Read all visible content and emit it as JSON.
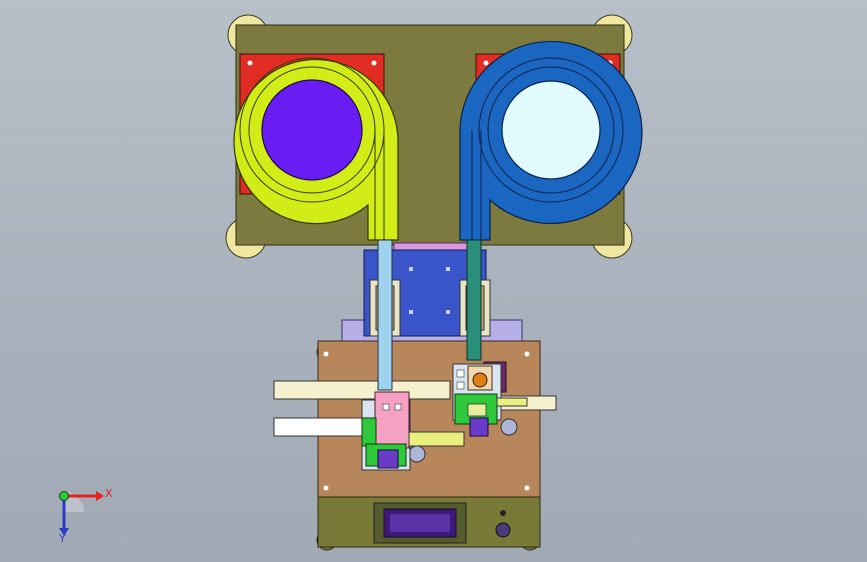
{
  "axes": {
    "x_label": "X",
    "y_label": "Y",
    "x_color": "#e8201e",
    "y_color": "#2d3cc8"
  },
  "colors": {
    "background": "#aab3bd",
    "top_plate": "#7c7a3f",
    "feeder_left": "#d2ec18",
    "feeder_left_bowl": "#6a1df2",
    "feeder_right": "#1a66c1",
    "feeder_right_bowl": "#e2fbff",
    "base_body": "#b7875b",
    "blue_block": "#3a55c9",
    "pink_block": "#f5a1c4",
    "green_pcb": "#2fc83a",
    "display_panel": "#3e1a78"
  }
}
